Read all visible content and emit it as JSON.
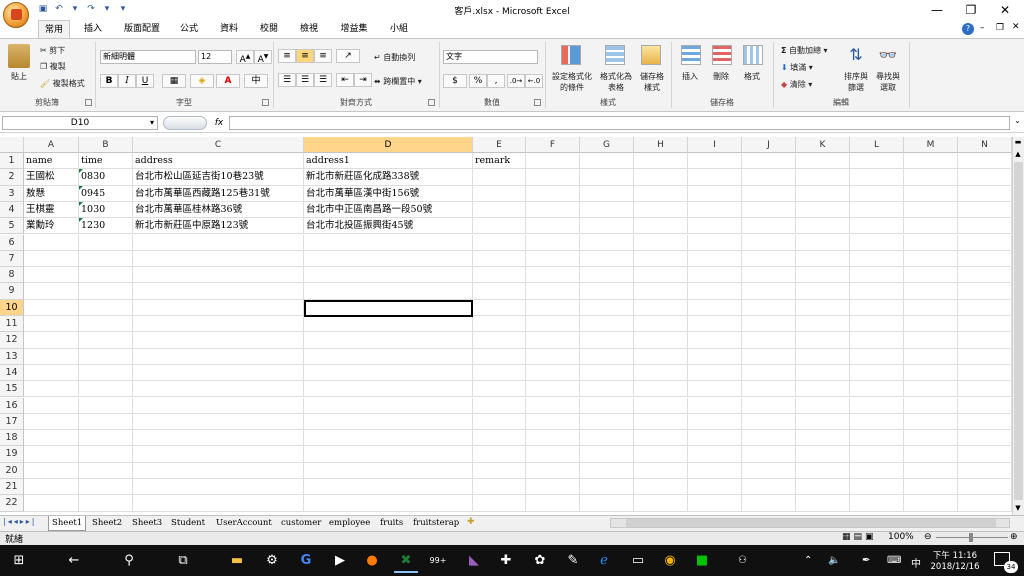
{
  "window": {
    "title": "客戶.xlsx - Microsoft Excel",
    "minimize_glyph": "—",
    "restore_glyph": "❐",
    "close_glyph": "✕"
  },
  "tabs": [
    "常用",
    "插入",
    "版面配置",
    "公式",
    "資料",
    "校閱",
    "檢視",
    "增益集",
    "小組"
  ],
  "active_tab": "常用",
  "ribbon": {
    "clipboard": {
      "group": "剪貼簿",
      "paste": "貼上",
      "cut": "剪下",
      "copy": "複製",
      "format_painter": "複製格式"
    },
    "font": {
      "group": "字型",
      "name": "新細明體",
      "size": "12",
      "bold": "B",
      "italic": "I",
      "underline": "U"
    },
    "alignment": {
      "group": "對齊方式",
      "wrap": "自動換列",
      "merge": "跨欄置中"
    },
    "number": {
      "group": "數值",
      "format": "文字",
      "currency": "$",
      "percent": "%",
      "comma": ","
    },
    "styles": {
      "group": "樣式",
      "conditional1": "設定格式化",
      "conditional2": "的條件",
      "table1": "格式化為",
      "table2": "表格",
      "cell1": "儲存格",
      "cell2": "樣式"
    },
    "cells": {
      "group": "儲存格",
      "insert": "插入",
      "delete": "刪除",
      "format": "格式"
    },
    "editing": {
      "group": "編輯",
      "autosum": "自動加總",
      "fill": "填滿",
      "clear": "清除",
      "sort1": "排序與",
      "sort2": "篩選",
      "find1": "尋找與",
      "find2": "選取"
    }
  },
  "formula_bar": {
    "name_box": "D10",
    "fx": "fx",
    "value": ""
  },
  "columns": [
    "A",
    "B",
    "C",
    "D",
    "E",
    "F",
    "G",
    "H",
    "I",
    "J",
    "K",
    "L",
    "M",
    "N"
  ],
  "selected_column": "D",
  "selected_row": "10",
  "rows": [
    [
      "name",
      "time",
      "address",
      "address1",
      "remark"
    ],
    [
      "王國松",
      "0830",
      "台北市松山區延吉街10巷23號",
      "新北市新莊區化成路338號",
      ""
    ],
    [
      "敖懸",
      "0945",
      "台北市萬華區西藏路125巷31號",
      "台北市萬華區漢中街156號",
      ""
    ],
    [
      "王棋靈",
      "1030",
      "台北市萬華區桂林路36號",
      "台北市中正區南昌路一段50號",
      ""
    ],
    [
      "業勳玲",
      "1230",
      "新北市新莊區中原路123號",
      "台北市北投區振興街45號",
      ""
    ]
  ],
  "row_numbers": [
    "1",
    "2",
    "3",
    "4",
    "5",
    "6",
    "7",
    "8",
    "9",
    "10",
    "11",
    "12",
    "13",
    "14",
    "15",
    "16",
    "17",
    "18",
    "19",
    "20",
    "21",
    "22"
  ],
  "sheets": [
    "Sheet1",
    "Sheet2",
    "Sheet3",
    "Student",
    "UserAccount",
    "customer",
    "employee",
    "fruits",
    "fruitsterap"
  ],
  "active_sheet": "Sheet1",
  "status": {
    "ready": "就緒",
    "zoom": "100%"
  },
  "taskbar": {
    "badge": "99+",
    "ime": "中",
    "time": "下午 11:16",
    "date": "2018/12/16",
    "notification_count": "34"
  }
}
